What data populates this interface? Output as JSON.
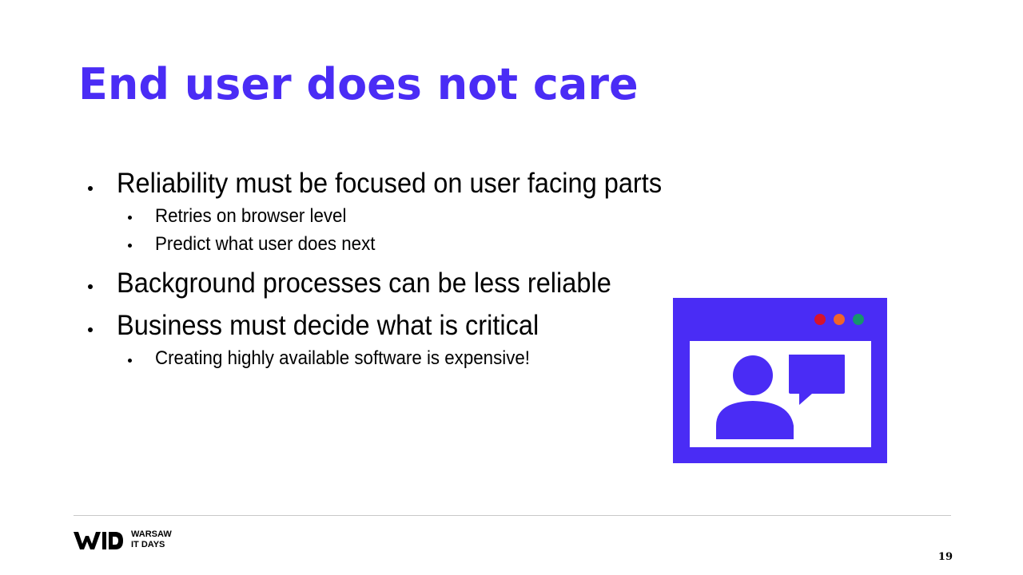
{
  "slide": {
    "title": "End user does not care",
    "bullets": [
      {
        "text": "Reliability must be focused on user facing parts",
        "sub": [
          "Retries on browser level",
          "Predict what user does next"
        ]
      },
      {
        "text": "Background processes can be less reliable",
        "sub": []
      },
      {
        "text": "Business must decide what is critical",
        "sub": [
          "Creating highly available software is expensive!"
        ]
      }
    ],
    "illustration_icon": "user-chat-window-icon",
    "window_dots": [
      "#d5132c",
      "#f0642a",
      "#16956b"
    ],
    "accent_color": "#4a2cf5"
  },
  "footer": {
    "logo_line1": "WARSAW",
    "logo_line2": "IT DAYS",
    "page_number": "19"
  }
}
